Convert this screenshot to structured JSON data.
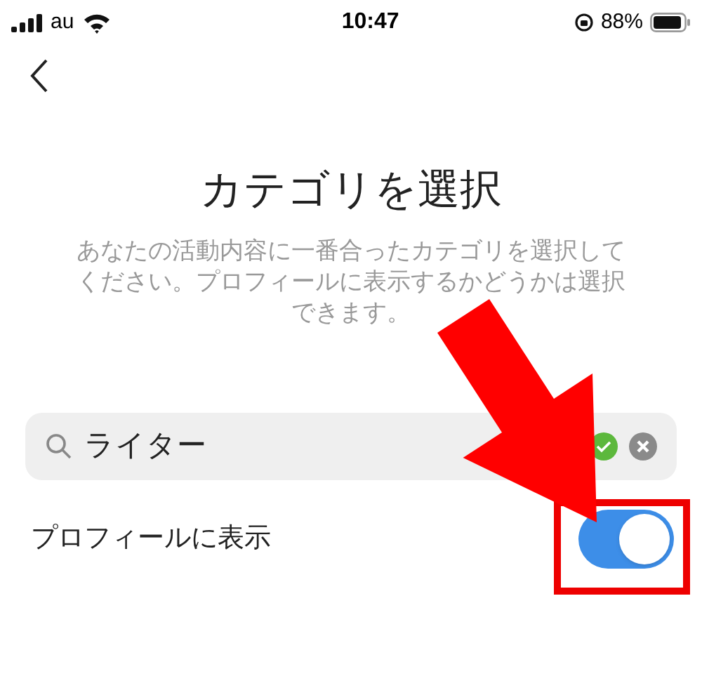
{
  "status_bar": {
    "carrier": "au",
    "time": "10:47",
    "battery": "88%"
  },
  "title": "カテゴリを選択",
  "description": "あなたの活動内容に一番合ったカテゴリを選択してください。プロフィールに表示するかどうかは選択できます。",
  "search": {
    "value": "ライター",
    "valid": true
  },
  "toggle": {
    "label": "プロフィールに表示",
    "on": true
  }
}
